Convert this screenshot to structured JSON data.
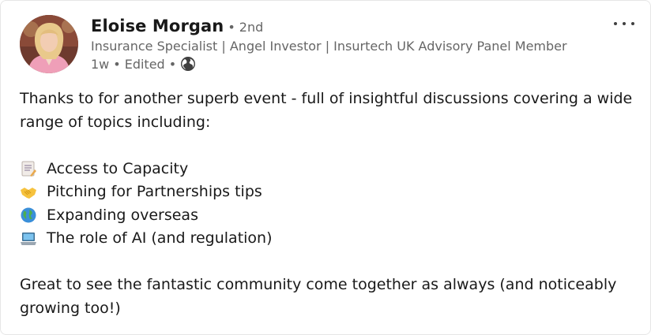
{
  "post": {
    "author": {
      "name": "Eloise Morgan",
      "degree_separator": "•",
      "degree": "2nd",
      "headline": "Insurance Specialist | Angel Investor | Insurtech UK Advisory Panel Member",
      "time": "1w",
      "dot1": "•",
      "edited": "Edited",
      "dot2": "•",
      "visibility_icon": "globe-icon"
    },
    "menu_icon": "more-horizontal-icon",
    "text": {
      "intro_line1": "Thanks to  for another superb event - full of insightful discussions covering a wide",
      "intro_line2": "range of topics including:",
      "bullets": [
        {
          "icon": "memo-emoji",
          "label": "Access to Capacity"
        },
        {
          "icon": "handshake-emoji",
          "label": "Pitching for Partnerships tips"
        },
        {
          "icon": "globe-emoji",
          "label": "Expanding overseas"
        },
        {
          "icon": "laptop-emoji",
          "label": "The role of AI (and regulation)"
        }
      ],
      "outro_line1": "Great to see the fantastic community come together as always (and noticeably",
      "outro_line2": "growing too!)"
    }
  }
}
